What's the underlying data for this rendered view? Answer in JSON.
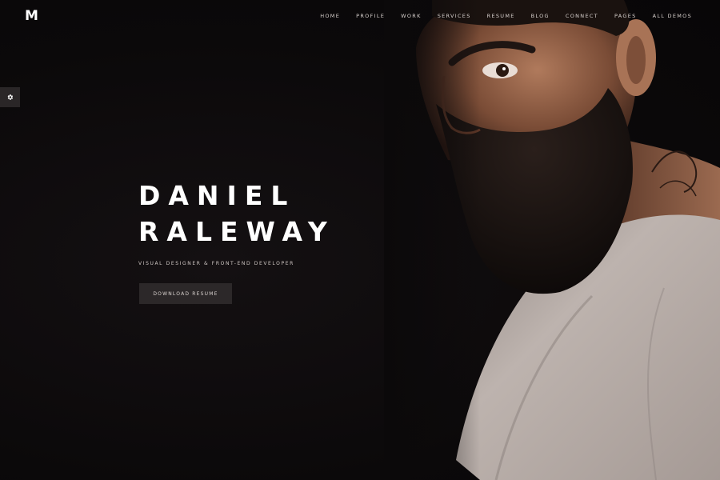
{
  "brand": {
    "logo": "M"
  },
  "nav": {
    "items": [
      {
        "label": "HOME"
      },
      {
        "label": "PROFILE"
      },
      {
        "label": "WORK"
      },
      {
        "label": "SERVICES"
      },
      {
        "label": "RESUME"
      },
      {
        "label": "BLOG"
      },
      {
        "label": "CONNECT"
      },
      {
        "label": "PAGES"
      },
      {
        "label": "ALL DEMOS"
      }
    ]
  },
  "settings": {
    "icon": "gear-icon"
  },
  "hero": {
    "first_name": "DANIEL",
    "last_name": "RALEWAY",
    "subtitle": "VISUAL DESIGNER & FRONT-END DEVELOPER",
    "button_label": "DOWNLOAD RESUME"
  },
  "colors": {
    "background": "#0c0a0b",
    "text": "#ffffff",
    "muted_text": "#d9d2cf",
    "button_bg": "#2c2829"
  }
}
